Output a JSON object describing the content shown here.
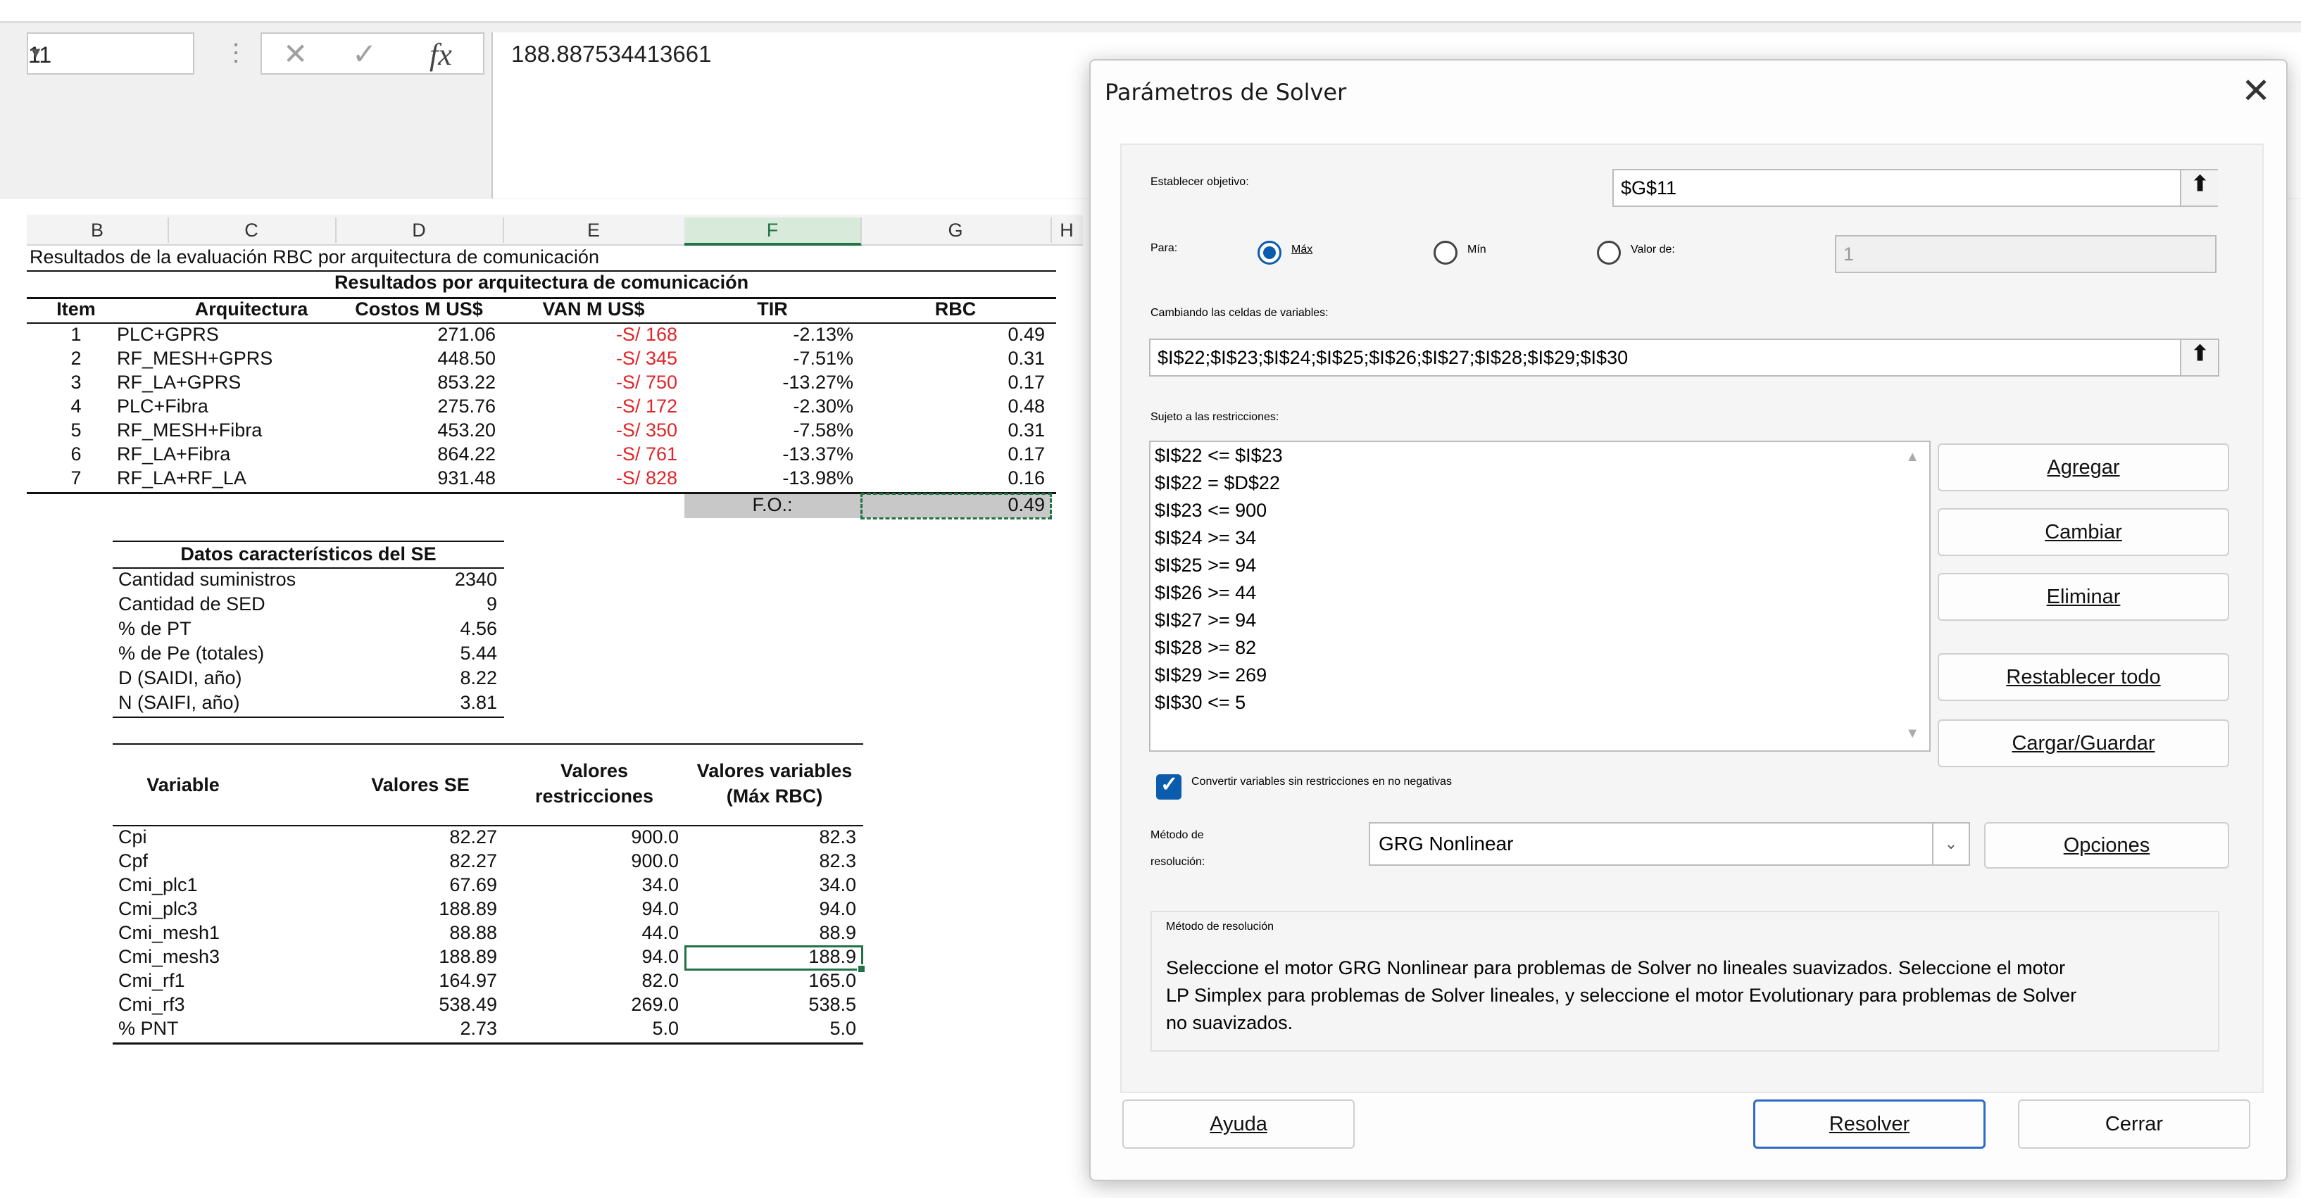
{
  "formula_bar": {
    "name_box": "11",
    "cancel_icon": "✕",
    "enter_icon": "✓",
    "fx_icon": "fx",
    "value": "188.887534413661"
  },
  "columns": [
    "B",
    "C",
    "D",
    "E",
    "F",
    "G",
    "H"
  ],
  "sheet": {
    "title": "Resultados de la evaluación RBC por arquitectura de comunicación",
    "table1_header": "Resultados por arquitectura de comunicación",
    "table1_cols": [
      "Item",
      "Arquitectura",
      "Costos M US$",
      "VAN M US$",
      "TIR",
      "RBC"
    ],
    "table1_rows": [
      [
        "1",
        "PLC+GPRS",
        "271.06",
        "-S/ 168",
        "-2.13%",
        "0.49"
      ],
      [
        "2",
        "RF_MESH+GPRS",
        "448.50",
        "-S/ 345",
        "-7.51%",
        "0.31"
      ],
      [
        "3",
        "RF_LA+GPRS",
        "853.22",
        "-S/ 750",
        "-13.27%",
        "0.17"
      ],
      [
        "4",
        "PLC+Fibra",
        "275.76",
        "-S/ 172",
        "-2.30%",
        "0.48"
      ],
      [
        "5",
        "RF_MESH+Fibra",
        "453.20",
        "-S/ 350",
        "-7.58%",
        "0.31"
      ],
      [
        "6",
        "RF_LA+Fibra",
        "864.22",
        "-S/ 761",
        "-13.37%",
        "0.17"
      ],
      [
        "7",
        "RF_LA+RF_LA",
        "931.48",
        "-S/ 828",
        "-13.98%",
        "0.16"
      ]
    ],
    "fo_label": "F.O.:",
    "fo_value": "0.49",
    "table2_header": "Datos característicos del SE",
    "table2_rows": [
      [
        "Cantidad suministros",
        "2340"
      ],
      [
        "Cantidad de SED",
        "9"
      ],
      [
        "% de PT",
        "4.56"
      ],
      [
        "% de Pe (totales)",
        "5.44"
      ],
      [
        "D (SAIDI, año)",
        "8.22"
      ],
      [
        "N (SAIFI, año)",
        "3.81"
      ]
    ],
    "table3_cols": [
      "Variable",
      "Valores SE",
      "Valores",
      "restricciones",
      "Valores variables",
      "(Máx RBC)"
    ],
    "table3_rows": [
      [
        "Cpi",
        "82.27",
        "900.0",
        "82.3"
      ],
      [
        "Cpf",
        "82.27",
        "900.0",
        "82.3"
      ],
      [
        "Cmi_plc1",
        "67.69",
        "34.0",
        "34.0"
      ],
      [
        "Cmi_plc3",
        "188.89",
        "94.0",
        "94.0"
      ],
      [
        "Cmi_mesh1",
        "88.88",
        "44.0",
        "88.9"
      ],
      [
        "Cmi_mesh3",
        "188.89",
        "94.0",
        "188.9"
      ],
      [
        "Cmi_rf1",
        "164.97",
        "82.0",
        "165.0"
      ],
      [
        "Cmi_rf3",
        "538.49",
        "269.0",
        "538.5"
      ],
      [
        "% PNT",
        "2.73",
        "5.0",
        "5.0"
      ]
    ]
  },
  "dialog": {
    "title": "Parámetros de Solver",
    "close_icon": "✕",
    "objective_label": "Establecer objetivo:",
    "objective_value": "$G$11",
    "ref_icon": "⬆",
    "para_label": "Para:",
    "opt_max": "Máx",
    "opt_min": "Mín",
    "opt_valor": "Valor de:",
    "valor_value": "1",
    "changing_label": "Cambiando las celdas de variables:",
    "changing_value": "$I$22;$I$23;$I$24;$I$25;$I$26;$I$27;$I$28;$I$29;$I$30",
    "constraints_label": "Sujeto a las restricciones:",
    "constraints": [
      "$I$22 <= $I$23",
      "$I$22 = $D$22",
      "$I$23 <= 900",
      "$I$24 >= 34",
      "$I$25 >= 94",
      "$I$26 >= 44",
      "$I$27 >= 94",
      "$I$28 >= 82",
      "$I$29 >= 269",
      "$I$30 <= 5"
    ],
    "btn_add": "Agregar",
    "btn_change": "Cambiar",
    "btn_delete": "Eliminar",
    "btn_reset": "Restablecer todo",
    "btn_load": "Cargar/Guardar",
    "nonneg_label": "Convertir variables sin restricciones en no negativas",
    "method_label_1": "Método de",
    "method_label_2": "resolución:",
    "method_value": "GRG Nonlinear",
    "btn_options": "Opciones",
    "desc_title": "Método de resolución",
    "desc_text_1": "Seleccione el motor GRG Nonlinear para problemas de Solver no lineales suavizados. Seleccione el motor",
    "desc_text_2": "LP Simplex para problemas de Solver lineales, y seleccione el motor Evolutionary para problemas de Solver",
    "desc_text_3": "no suavizados.",
    "btn_help": "Ayuda",
    "btn_solve": "Resolver",
    "btn_close": "Cerrar"
  }
}
